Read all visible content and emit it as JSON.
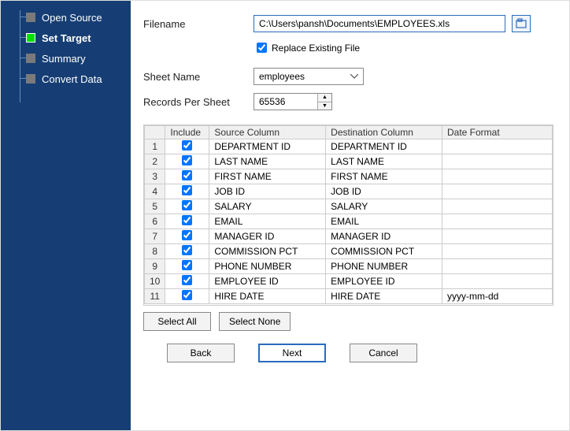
{
  "nav": {
    "items": [
      {
        "label": "Open Source",
        "active": false
      },
      {
        "label": "Set Target",
        "active": true
      },
      {
        "label": "Summary",
        "active": false
      },
      {
        "label": "Convert Data",
        "active": false
      }
    ]
  },
  "form": {
    "filename_label": "Filename",
    "filename_value": "C:\\Users\\pansh\\Documents\\EMPLOYEES.xls",
    "replace_label": "Replace Existing File",
    "replace_checked": true,
    "sheet_label": "Sheet Name",
    "sheet_value": "employees",
    "records_label": "Records Per Sheet",
    "records_value": "65536"
  },
  "table": {
    "headers": {
      "include": "Include",
      "source": "Source Column",
      "dest": "Destination Column",
      "datefmt": "Date Format"
    },
    "rows": [
      {
        "n": "1",
        "inc": true,
        "src": "DEPARTMENT ID",
        "dst": "DEPARTMENT ID",
        "fmt": ""
      },
      {
        "n": "2",
        "inc": true,
        "src": "LAST NAME",
        "dst": "LAST NAME",
        "fmt": ""
      },
      {
        "n": "3",
        "inc": true,
        "src": "FIRST NAME",
        "dst": "FIRST NAME",
        "fmt": ""
      },
      {
        "n": "4",
        "inc": true,
        "src": "JOB ID",
        "dst": "JOB ID",
        "fmt": ""
      },
      {
        "n": "5",
        "inc": true,
        "src": "SALARY",
        "dst": "SALARY",
        "fmt": ""
      },
      {
        "n": "6",
        "inc": true,
        "src": "EMAIL",
        "dst": "EMAIL",
        "fmt": ""
      },
      {
        "n": "7",
        "inc": true,
        "src": "MANAGER ID",
        "dst": "MANAGER ID",
        "fmt": ""
      },
      {
        "n": "8",
        "inc": true,
        "src": "COMMISSION PCT",
        "dst": "COMMISSION PCT",
        "fmt": ""
      },
      {
        "n": "9",
        "inc": true,
        "src": "PHONE NUMBER",
        "dst": "PHONE NUMBER",
        "fmt": ""
      },
      {
        "n": "10",
        "inc": true,
        "src": "EMPLOYEE ID",
        "dst": "EMPLOYEE ID",
        "fmt": ""
      },
      {
        "n": "11",
        "inc": true,
        "src": "HIRE DATE",
        "dst": "HIRE DATE",
        "fmt": "yyyy-mm-dd"
      }
    ]
  },
  "buttons": {
    "select_all": "Select All",
    "select_none": "Select None",
    "back": "Back",
    "next": "Next",
    "cancel": "Cancel"
  }
}
